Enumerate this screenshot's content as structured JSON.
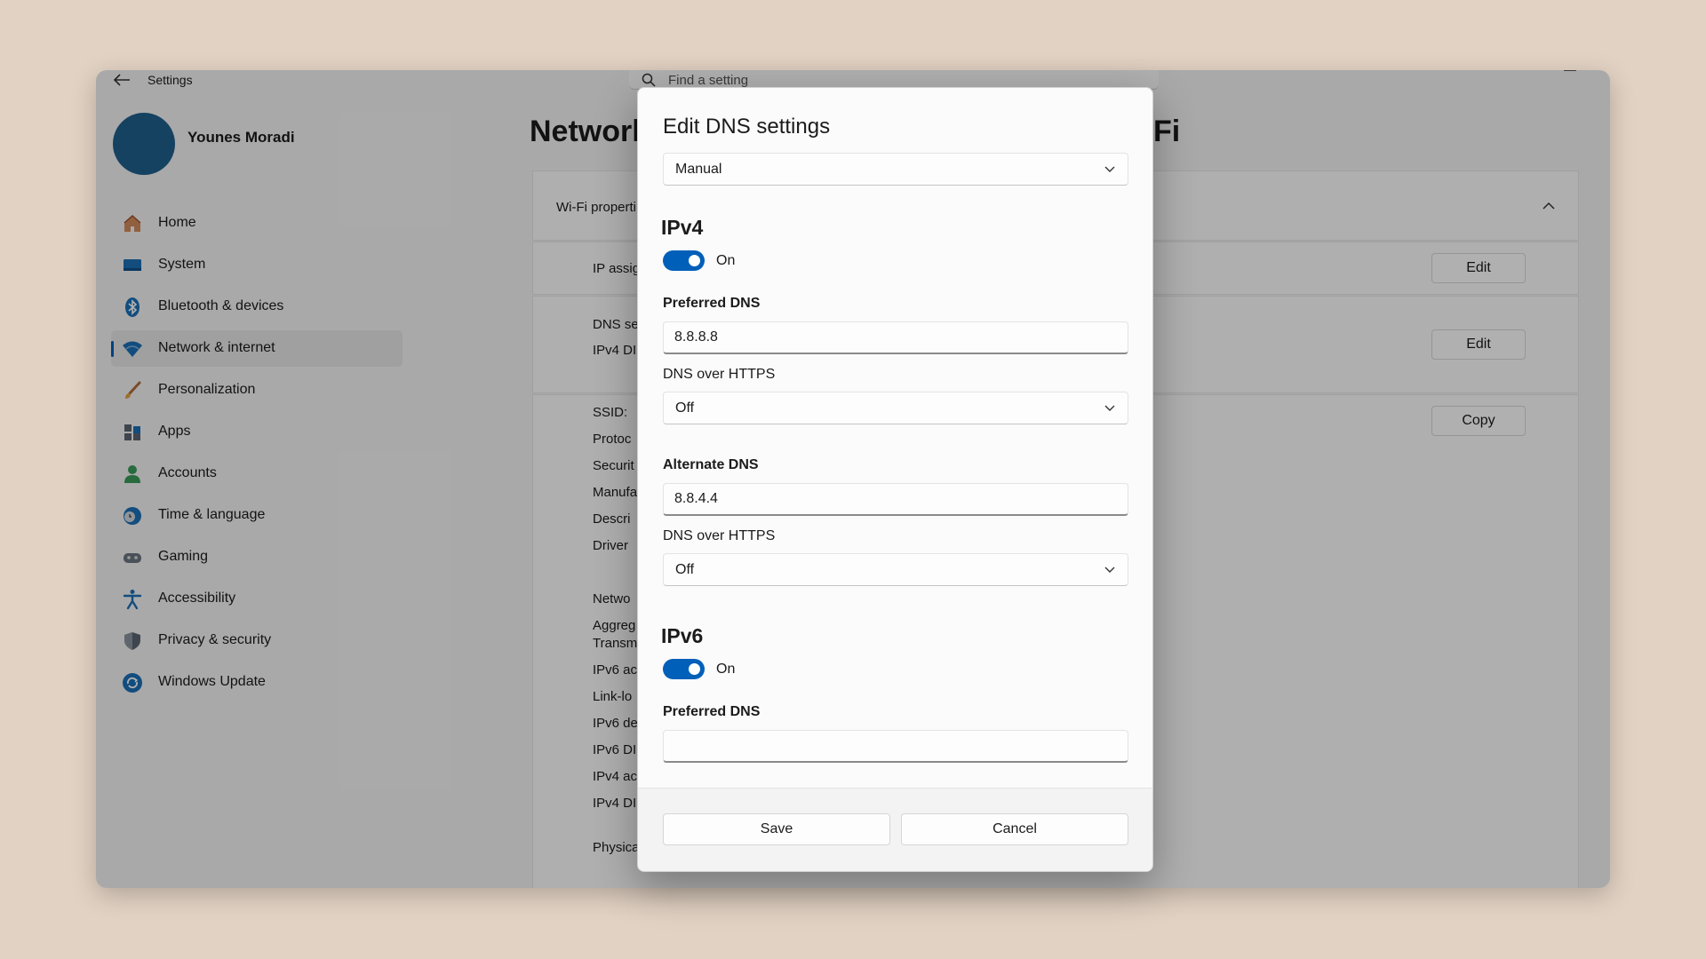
{
  "window": {
    "title": "Settings"
  },
  "search": {
    "placeholder": "Find a setting"
  },
  "profile": {
    "name": "Younes Moradi"
  },
  "sidebar": {
    "items": [
      {
        "label": "Home",
        "icon": "home-icon"
      },
      {
        "label": "System",
        "icon": "system-icon"
      },
      {
        "label": "Bluetooth & devices",
        "icon": "bluetooth-icon"
      },
      {
        "label": "Network & internet",
        "icon": "wifi-icon",
        "active": true
      },
      {
        "label": "Personalization",
        "icon": "brush-icon"
      },
      {
        "label": "Apps",
        "icon": "apps-icon"
      },
      {
        "label": "Accounts",
        "icon": "person-icon"
      },
      {
        "label": "Time & language",
        "icon": "globe-clock-icon"
      },
      {
        "label": "Gaming",
        "icon": "gamepad-icon"
      },
      {
        "label": "Accessibility",
        "icon": "accessibility-icon"
      },
      {
        "label": "Privacy & security",
        "icon": "shield-icon"
      },
      {
        "label": "Windows Update",
        "icon": "update-icon"
      }
    ]
  },
  "page": {
    "title_left": "Network",
    "title_right": "Fi"
  },
  "background": {
    "card_header": "Wi-Fi properti",
    "ip_assignment": "IP assig",
    "dns_server": "DNS se",
    "ipv4_dns": "IPv4 DI",
    "edit_label": "Edit",
    "copy_label": "Copy",
    "details": [
      "SSID:",
      "Protoc",
      "Securit",
      "Manufa",
      "Descri",
      "Driver",
      "Netwo",
      "Aggreg",
      "Transm",
      "IPv6 ac",
      "Link-lo",
      "IPv6 de",
      "IPv6 DI",
      "IPv4 ac",
      "IPv4 DI",
      "Physica"
    ]
  },
  "dialog": {
    "title": "Edit DNS settings",
    "mode": "Manual",
    "ipv4": {
      "heading": "IPv4",
      "toggle_label": "On",
      "preferred_label": "Preferred DNS",
      "preferred_value": "8.8.8.8",
      "doh_label_1": "DNS over HTTPS",
      "doh_value_1": "Off",
      "alternate_label": "Alternate DNS",
      "alternate_value": "8.8.4.4",
      "doh_label_2": "DNS over HTTPS",
      "doh_value_2": "Off"
    },
    "ipv6": {
      "heading": "IPv6",
      "toggle_label": "On",
      "preferred_label": "Preferred DNS",
      "preferred_value": ""
    },
    "save_label": "Save",
    "cancel_label": "Cancel"
  },
  "colors": {
    "accent": "#005fb8",
    "background": "#e2d2c3",
    "window": "#f3f3f3"
  }
}
